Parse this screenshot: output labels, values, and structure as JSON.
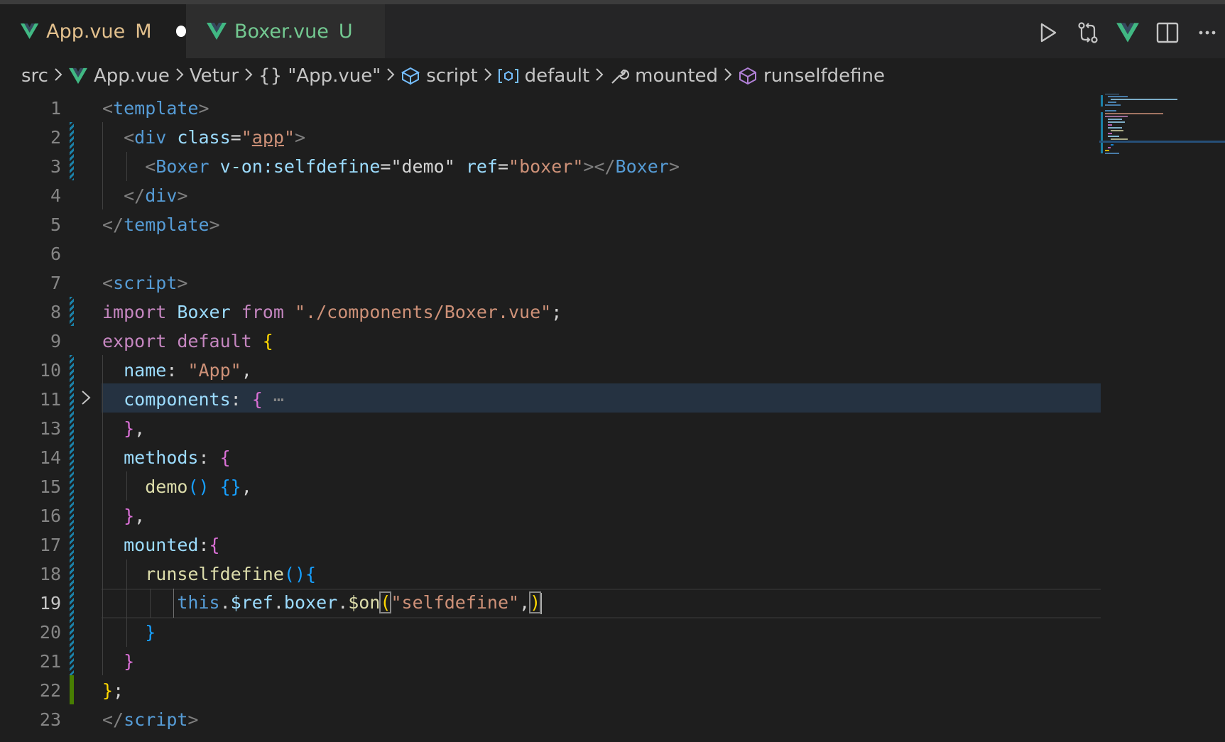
{
  "tabs": [
    {
      "label": "App.vue",
      "badge": "M",
      "state": "modified"
    },
    {
      "label": "Boxer.vue",
      "badge": "U",
      "state": "untracked"
    }
  ],
  "actions": [
    "run-icon",
    "compare-changes-icon",
    "vue-icon",
    "split-editor-icon",
    "more-icon"
  ],
  "breadcrumb": {
    "src": "src",
    "file": "App.vue",
    "vetur": "Vetur",
    "obj": "{} \"App.vue\"",
    "script": "script",
    "default": "default",
    "mounted": "mounted",
    "method": "runselfdefine"
  },
  "editor": {
    "line_numbers": [
      "1",
      "2",
      "3",
      "4",
      "5",
      "6",
      "7",
      "8",
      "9",
      "10",
      "11",
      "13",
      "14",
      "15",
      "16",
      "17",
      "18",
      "19",
      "20",
      "21",
      "22",
      "23"
    ],
    "current_line": "19",
    "folded_line": "11"
  },
  "colors": {
    "background": "#1e1e1e",
    "tag": "#569cd6",
    "string": "#ce9178",
    "keyword": "#c586c0",
    "property": "#9cdcfe",
    "function": "#dcdcaa",
    "modified_badge": "#e2c08d",
    "untracked_badge": "#73c991",
    "gutter_modified": "#1b81a8",
    "gutter_added": "#487e02"
  }
}
